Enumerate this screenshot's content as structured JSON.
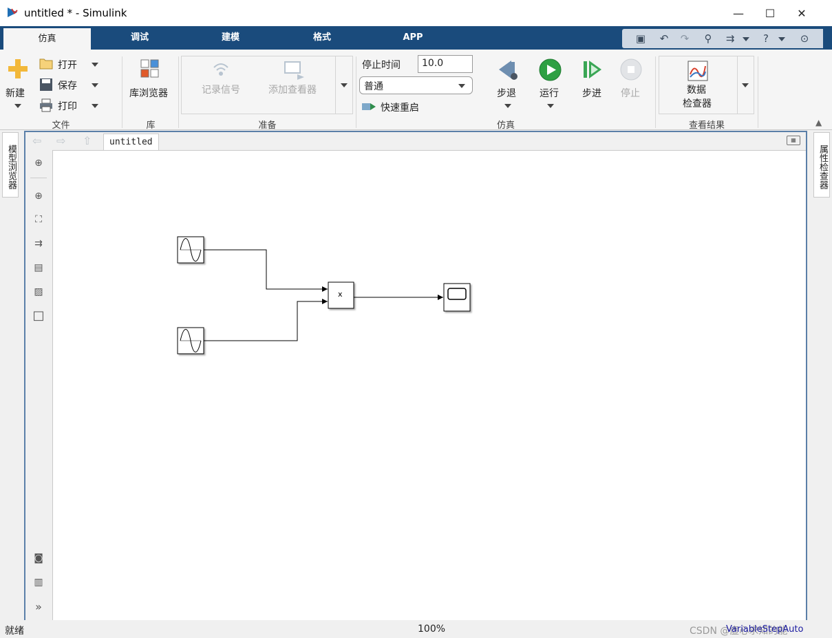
{
  "window": {
    "title": "untitled * - Simulink",
    "minimize": "—",
    "maximize": "☐",
    "close": "✕"
  },
  "tabs": [
    {
      "label": "仿真"
    },
    {
      "label": "调试"
    },
    {
      "label": "建模"
    },
    {
      "label": "格式"
    },
    {
      "label": "APP"
    }
  ],
  "ribbon": {
    "file": {
      "new_label": "新建",
      "open_label": "打开",
      "save_label": "保存",
      "print_label": "打印",
      "section": "文件"
    },
    "library": {
      "browser_label": "库浏览器",
      "section": "库"
    },
    "prepare": {
      "log_signals": "记录信号",
      "add_viewer": "添加查看器",
      "section": "准备"
    },
    "simulate": {
      "stop_time_label": "停止时间",
      "stop_time_value": "10.0",
      "mode": "普通",
      "fast_restart": "快速重启",
      "step_back": "步退",
      "run": "运行",
      "step_forward": "步进",
      "stop": "停止",
      "section": "仿真"
    },
    "review": {
      "inspector_line1": "数据",
      "inspector_line2": "检查器",
      "section": "查看结果"
    }
  },
  "left_panel": {
    "model_browser": "模型浏览器"
  },
  "right_panel": {
    "property_inspector": "属性检查器"
  },
  "editor": {
    "breadcrumb": "untitled",
    "product_block_label": "x"
  },
  "status": {
    "state": "就绪",
    "zoom": "100%",
    "solver": "VariableStepAuto",
    "watermark": "CSDN @虚心求知的能"
  },
  "colors": {
    "tab_bar": "#1a4b7c",
    "run_green": "#2ea043",
    "solver_text": "#1a1aa0",
    "editor_border": "#5a7fa8"
  }
}
